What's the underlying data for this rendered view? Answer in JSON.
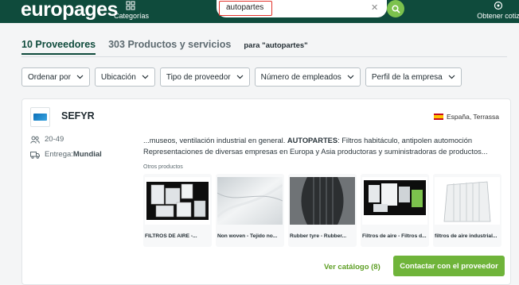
{
  "header": {
    "logo": "europages",
    "categories_label": "Categorías",
    "search_value": "autopartes",
    "quote_label": "Obtener cotiz"
  },
  "tabs": {
    "suppliers": "10 Proveedores",
    "products": "303 Productos y servicios",
    "query": "para \"autopartes\""
  },
  "filters": [
    "Ordenar por",
    "Ubicación",
    "Tipo de proveedor",
    "Número de empleados",
    "Perfil de la empresa"
  ],
  "company": {
    "name": "SEFYR",
    "location": "España, Terrassa",
    "employees": "20-49",
    "delivery_prefix": "Entrega: ",
    "delivery_value": "Mundial",
    "desc_line1_pre": "...museos, ventilación industrial en general. ",
    "desc_line1_bold": "AUTOPARTES",
    "desc_line1_post": ": Filtros habitáculo, antipolen automoción",
    "desc_line2": "Representaciones de diversas empresas en Europa y Asia productoras y suministradoras de productos...",
    "other_products_label": "Otros productos",
    "products": [
      "FILTROS DE AIRE -...",
      "Non woven - Tejido no...",
      "Rubber tyre - Rubber...",
      "Filtros de aire - Filtros d...",
      "filtros de aire industrial..."
    ],
    "catalog_label": "Ver catálogo (8)",
    "contact_label": "Contactar con el proveedor"
  },
  "colors": {
    "header_bg": "#0f4b3c",
    "accent_green": "#6fb43a",
    "search_highlight": "#e2332b"
  }
}
